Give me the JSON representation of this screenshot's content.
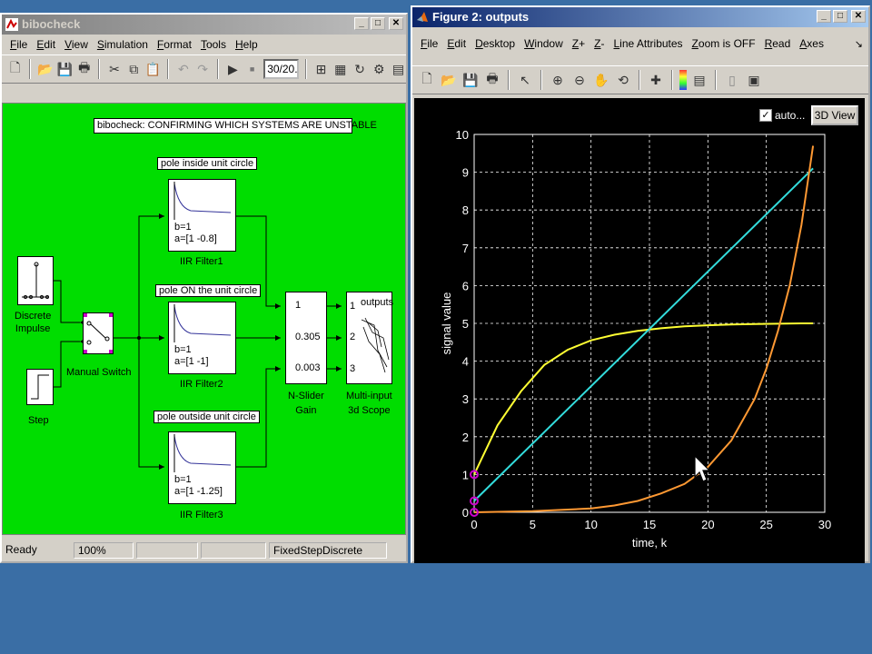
{
  "simulink": {
    "title": "bibocheck",
    "menu": [
      "File",
      "Edit",
      "View",
      "Simulation",
      "Format",
      "Tools",
      "Help"
    ],
    "sim_stop_time": "30/20...",
    "diagram_title": "bibocheck: CONFIRMING WHICH SYSTEMS ARE UNSTABLE",
    "labels": {
      "discrete_impulse": "Discrete\nImpulse",
      "step": "Step",
      "manual_switch": "Manual Switch",
      "pole_inside": "pole inside unit circle",
      "pole_on": "pole ON the unit circle",
      "pole_outside": "pole outside unit circle",
      "filter1_b": "b=1",
      "filter1_a": "a=[1 -0.8]",
      "filter1_name": "IIR Filter1",
      "filter2_b": "b=1",
      "filter2_a": "a=[1 -1]",
      "filter2_name": "IIR Filter2",
      "filter3_b": "b=1",
      "filter3_a": "a=[1 -1.25]",
      "filter3_name": "IIR Filter3",
      "gain_1": "1",
      "gain_2": "0.305",
      "gain_3": "0.003",
      "gain_name": "N-Slider\nGain",
      "scope_title": "outputs",
      "scope_p1": "1",
      "scope_p2": "2",
      "scope_p3": "3",
      "scope_name": "Multi-input\n3d Scope"
    },
    "status": {
      "ready": "Ready",
      "zoom": "100%",
      "solver": "FixedStepDiscrete"
    }
  },
  "figure": {
    "title": "Figure 2: outputs",
    "menu": [
      "File",
      "Edit",
      "Desktop",
      "Window",
      "Z+",
      "Z-",
      "Line Attributes",
      "Zoom is OFF",
      "Read",
      "Axes"
    ],
    "auto_checkbox_label": "auto...",
    "auto_checked": true,
    "view3d_button": "3D View"
  },
  "colors": {
    "desktop": "#3a6ea5",
    "canvas": "#00dd00",
    "series_yellow": "#ffff33",
    "series_cyan": "#33dddd",
    "series_orange": "#ff9933",
    "marker": "#cc00cc"
  },
  "chart_data": {
    "type": "line",
    "xlabel": "time, k",
    "ylabel": "signal value",
    "xlim": [
      0,
      30
    ],
    "ylim": [
      0,
      10
    ],
    "xticks": [
      0,
      5,
      10,
      15,
      20,
      25,
      30
    ],
    "yticks": [
      0,
      1,
      2,
      3,
      4,
      5,
      6,
      7,
      8,
      9,
      10
    ],
    "grid": true,
    "background": "black",
    "series": [
      {
        "color": "#ffff33",
        "x": [
          0,
          2,
          4,
          6,
          8,
          10,
          12,
          14,
          16,
          18,
          20,
          22,
          24,
          26,
          28,
          29
        ],
        "y": [
          1.0,
          2.3,
          3.2,
          3.9,
          4.3,
          4.55,
          4.7,
          4.8,
          4.87,
          4.92,
          4.95,
          4.97,
          4.98,
          4.99,
          5.0,
          5.0
        ]
      },
      {
        "color": "#33dddd",
        "x": [
          0,
          29
        ],
        "y": [
          0.3,
          9.1
        ]
      },
      {
        "color": "#ff9933",
        "x": [
          0,
          5,
          10,
          12,
          14,
          16,
          18,
          20,
          22,
          24,
          25,
          26,
          27,
          28,
          29
        ],
        "y": [
          0.0,
          0.03,
          0.1,
          0.18,
          0.3,
          0.5,
          0.75,
          1.2,
          1.9,
          3.0,
          3.8,
          4.8,
          6.0,
          7.6,
          9.7
        ]
      }
    ],
    "markers_at_x0": [
      0.0,
      0.3,
      1.0
    ]
  }
}
